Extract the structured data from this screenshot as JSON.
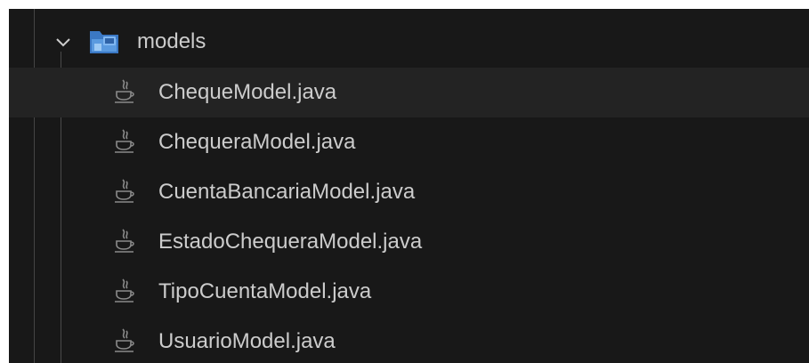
{
  "explorer": {
    "folder": {
      "name": "models",
      "icon": "models-folder-icon",
      "expanded": true
    },
    "files": [
      {
        "name": "ChequeModel.java",
        "icon": "java-file-icon"
      },
      {
        "name": "ChequeraModel.java",
        "icon": "java-file-icon"
      },
      {
        "name": "CuentaBancariaModel.java",
        "icon": "java-file-icon"
      },
      {
        "name": "EstadoChequeraModel.java",
        "icon": "java-file-icon"
      },
      {
        "name": "TipoCuentaModel.java",
        "icon": "java-file-icon"
      },
      {
        "name": "UsuarioModel.java",
        "icon": "java-file-icon"
      }
    ]
  },
  "colors": {
    "background": "#181818",
    "text": "#cccccc",
    "hover_row": "#232323",
    "indent_guide": "#454545",
    "folder_icon_blue": "#4a90d9",
    "java_icon": "#8a8a8a"
  }
}
